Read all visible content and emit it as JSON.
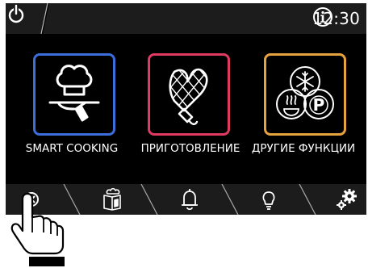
{
  "statusbar": {
    "time": "12:30",
    "icons": [
      "power-icon",
      "info-icon"
    ]
  },
  "tiles": [
    {
      "label": "SMART COOKING",
      "icon": "chef-hat-cloche-icon",
      "color": "#3b6ddb"
    },
    {
      "label": "ПРИГОТОВЛЕНИЕ",
      "icon": "oven-mitt-icon",
      "color": "#e03a61"
    },
    {
      "label": "ДРУГИЕ ФУНКЦИИ",
      "icon": "defrost-steam-proof-icon",
      "color": "#e5a23f"
    }
  ],
  "bottom_nav": {
    "icons": [
      "cancel-icon",
      "recipe-book-icon",
      "bell-icon",
      "lightbulb-icon",
      "settings-icon"
    ]
  },
  "colors": {
    "background": "#000000",
    "bar": "#1c1c1c",
    "smart": "#3b6ddb",
    "cook": "#e03a61",
    "other": "#e5a23f"
  }
}
